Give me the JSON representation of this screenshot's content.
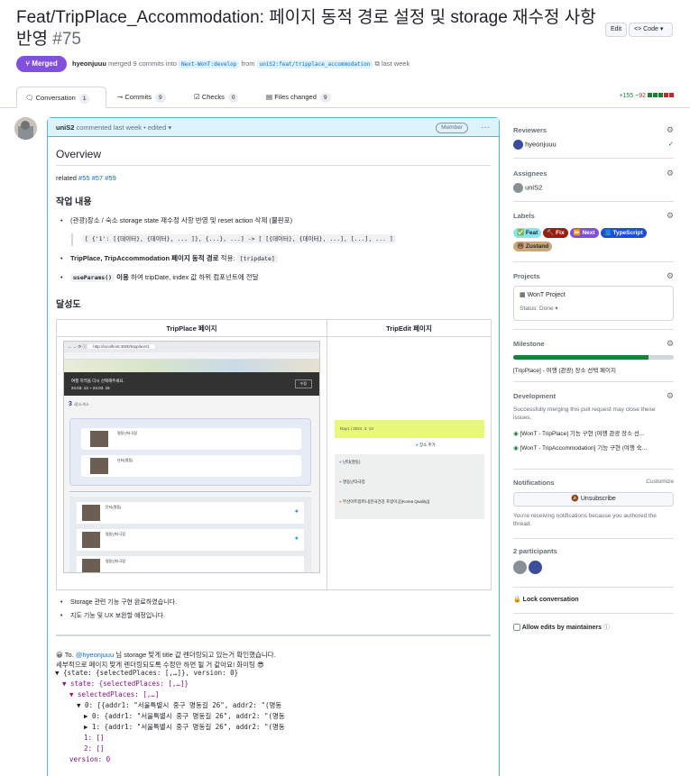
{
  "pr": {
    "title": "Feat/TripPlace_Accommodation: 페이지 동적 경로 설정 및 storage 재수정 사항 반영",
    "number": "#75",
    "edit_label": "Edit",
    "code_label": "Code",
    "status": "Merged",
    "author": "hyeonjuuu",
    "merged_text": "merged 9 commits into",
    "base_branch": "Next-WonT:develop",
    "from_text": "from",
    "head_branch": "uniS2:feat/tripplace_accommodation",
    "time": "last week"
  },
  "tabs": [
    {
      "label": "Conversation",
      "count": "1"
    },
    {
      "label": "Commits",
      "count": "9"
    },
    {
      "label": "Checks",
      "count": "0"
    },
    {
      "label": "Files changed",
      "count": "9"
    }
  ],
  "diffstat": {
    "add": "+155",
    "del": "−92"
  },
  "comment": {
    "author": "uniS2",
    "header_text": "commented last week • edited",
    "role": "Member",
    "overview": "Overview",
    "related_label": "related",
    "related": [
      "#55",
      "#57",
      "#59"
    ],
    "work_title": "작업 내용",
    "item1": "(관광)장소 / 숙소 storage state 재수정 사항 반영 및 reset action 삭제 (뿔핀포)",
    "item1_code": "[ {'1': [{데이터}, {데이터}, ... ]}, {...}, ...] -> [ [{데이터}, {데이터}, ...], [...], ... ]",
    "item2_bold": "TripPlace, TripAccommodation 페이지 동적 경로",
    "item2_rest": "적용:",
    "item2_code": "[tripdate]",
    "item3_code": "useParams()",
    "item3_bold": "이용",
    "item3_rest": "하여 tripDate, index 값 하위 컴포넌트에 전달",
    "achieve_title": "달성도",
    "col1": "TripPlace 페이지",
    "col2": "TripEdit 페이지",
    "done1": "Storage 관련 기능 구현 완료하였습니다.",
    "done2": "지도 기능 및 UX 보완할 예정입니다.",
    "note_to": "To.",
    "note_mention": "@hyeonjuuu",
    "note_rest": "님 storage 맞게 title 값 렌더링되고 있는거 확인했습니다.",
    "note_line2": "세부적으로 페이지 맞게 렌더링되도록 수정만 하면 될 거 같아요! 화이팅 😎"
  },
  "screenshot1": {
    "url": "http://localhost:3000/tripplace/1",
    "banner": "여행 지역을 다시 선택해주세요.",
    "banner_dates": "24.03. 13 ~ 24.03. 15",
    "banner_btn": "수정",
    "count": "3",
    "count_sub": "/장소/숙소",
    "items": [
      "명동난타극장",
      "난타(명동)",
      "단티(명동)",
      "명동난타극장",
      "명동난타극장"
    ]
  },
  "screenshot2": {
    "day_label": "Day1 | 2024. 3. 13",
    "add_label": "장소 추가",
    "places": [
      "난타(명동)",
      "명동난타극장",
      "부산아트컴퍼니[한국건강 프랑이공(Korea Quality)]"
    ]
  },
  "console": [
    "▼ {state: {selectedPlaces: [,…]}, version: 0}",
    "▼ state: {selectedPlaces: [,…]}",
    "▼ selectedPlaces: [,…]",
    "▼ 0: [{addr1: \"서울특별시 중구 명동길 26\", addr2: \"(명동",
    "▶ 0: {addr1: \"서울특별시 중구 명동길 26\", addr2: \"(명동",
    "▶ 1: {addr1: \"서울특별시 중구 명동길 26\", addr2: \"(명동",
    "1: []",
    "2: []",
    "version: 0"
  ],
  "sidebar": {
    "reviewers_label": "Reviewers",
    "reviewer": "hyeonjuuu",
    "assignees_label": "Assignees",
    "assignee": "uniS2",
    "labels_label": "Labels",
    "labels": [
      {
        "name": "✅ Feat",
        "color": "#8be3f5",
        "fg": "#1f2328"
      },
      {
        "name": "🔨 Fix",
        "color": "#9a1f12",
        "fg": "#ffffff"
      },
      {
        "name": "⏩ Next",
        "color": "#7f4fe0",
        "fg": "#ffffff"
      },
      {
        "name": "📘 TypeScript",
        "color": "#1d4ed8",
        "fg": "#ffffff"
      },
      {
        "name": "🐻 Zustand",
        "color": "#c9a97a",
        "fg": "#1f2328"
      }
    ],
    "projects_label": "Projects",
    "project_name": "WonT Project",
    "project_status": "Status: Done",
    "milestone_label": "Milestone",
    "milestone_progress": 0.84,
    "milestone_name": "[TripPlace] - 여행 (관광) 장소 선택 페이지",
    "development_label": "Development",
    "development_text": "Successfully merging this pull request may close these issues.",
    "issue1": "[WonT - TripPlace] 기능 구현 (여행 관광 장소 선...",
    "issue2": "[WonT - TripAccommodation] 기능 구현 (여행 숙...",
    "notifications_label": "Notifications",
    "customize": "Customize",
    "unsubscribe": "Unsubscribe",
    "notif_reason": "You're receiving notifications because you authored the thread.",
    "participants_label": "2 participants",
    "lock": "Lock conversation",
    "allow_edits": "Allow edits by maintainers"
  }
}
